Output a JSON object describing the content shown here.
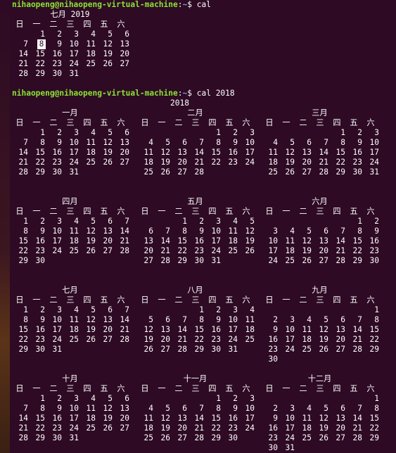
{
  "prompt": {
    "user_host": "nihaopeng@nihaopeng-virtual-machine",
    "path": "~",
    "symbol": "$"
  },
  "commands": [
    "cal",
    "cal 2018"
  ],
  "weekdays": [
    "日",
    "一",
    "二",
    "三",
    "四",
    "五",
    "六"
  ],
  "cal_2019_july": {
    "title": "七月 2019",
    "first_weekday": 1,
    "days": 31,
    "today": 8
  },
  "year_2018": {
    "year": "2018",
    "months": [
      {
        "name": "一月",
        "first_weekday": 1,
        "days": 31
      },
      {
        "name": "二月",
        "first_weekday": 4,
        "days": 28
      },
      {
        "name": "三月",
        "first_weekday": 4,
        "days": 31
      },
      {
        "name": "四月",
        "first_weekday": 0,
        "days": 30
      },
      {
        "name": "五月",
        "first_weekday": 2,
        "days": 31
      },
      {
        "name": "六月",
        "first_weekday": 5,
        "days": 30
      },
      {
        "name": "七月",
        "first_weekday": 0,
        "days": 31
      },
      {
        "name": "八月",
        "first_weekday": 3,
        "days": 31
      },
      {
        "name": "九月",
        "first_weekday": 6,
        "days": 30
      },
      {
        "name": "十月",
        "first_weekday": 1,
        "days": 31
      },
      {
        "name": "十一月",
        "first_weekday": 4,
        "days": 30
      },
      {
        "name": "十二月",
        "first_weekday": 6,
        "days": 31
      }
    ]
  }
}
